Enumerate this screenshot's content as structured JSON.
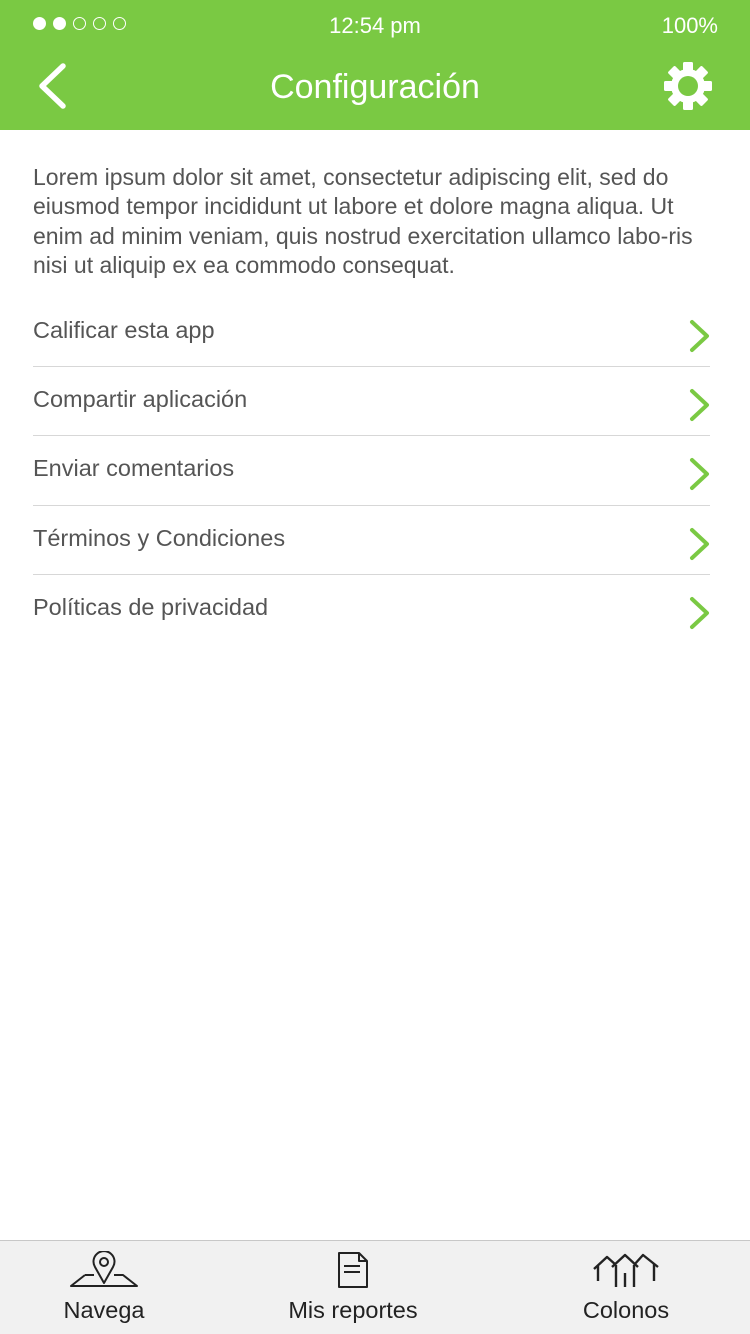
{
  "status_bar": {
    "time": "12:54 pm",
    "battery": "100%",
    "signal_bars_filled": 2,
    "signal_bars_total": 5
  },
  "header": {
    "title": "Configuración",
    "back_icon": "chevron-left-icon",
    "settings_icon": "gear-icon"
  },
  "intro": {
    "text": "Lorem ipsum dolor sit amet, consectetur adipiscing elit, sed do eiusmod tempor incididunt ut labore et dolore magna aliqua. Ut enim ad minim veniam, quis nostrud exercitation ullamco labo-ris nisi ut aliquip ex ea commodo consequat."
  },
  "menu": {
    "items": [
      {
        "label": "Calificar esta app"
      },
      {
        "label": "Compartir aplicación"
      },
      {
        "label": "Enviar comentarios"
      },
      {
        "label": "Términos y Condiciones"
      },
      {
        "label": "Políticas de privacidad"
      }
    ]
  },
  "tabbar": {
    "tabs": [
      {
        "label": "Navega",
        "icon": "map-pin-icon"
      },
      {
        "label": "Mis reportes",
        "icon": "document-icon"
      },
      {
        "label": "Colonos",
        "icon": "houses-icon"
      }
    ]
  },
  "colors": {
    "accent": "#7ac943",
    "text": "#555555",
    "divider": "#d7d7d7",
    "tabbar_bg": "#f1f1f1"
  }
}
